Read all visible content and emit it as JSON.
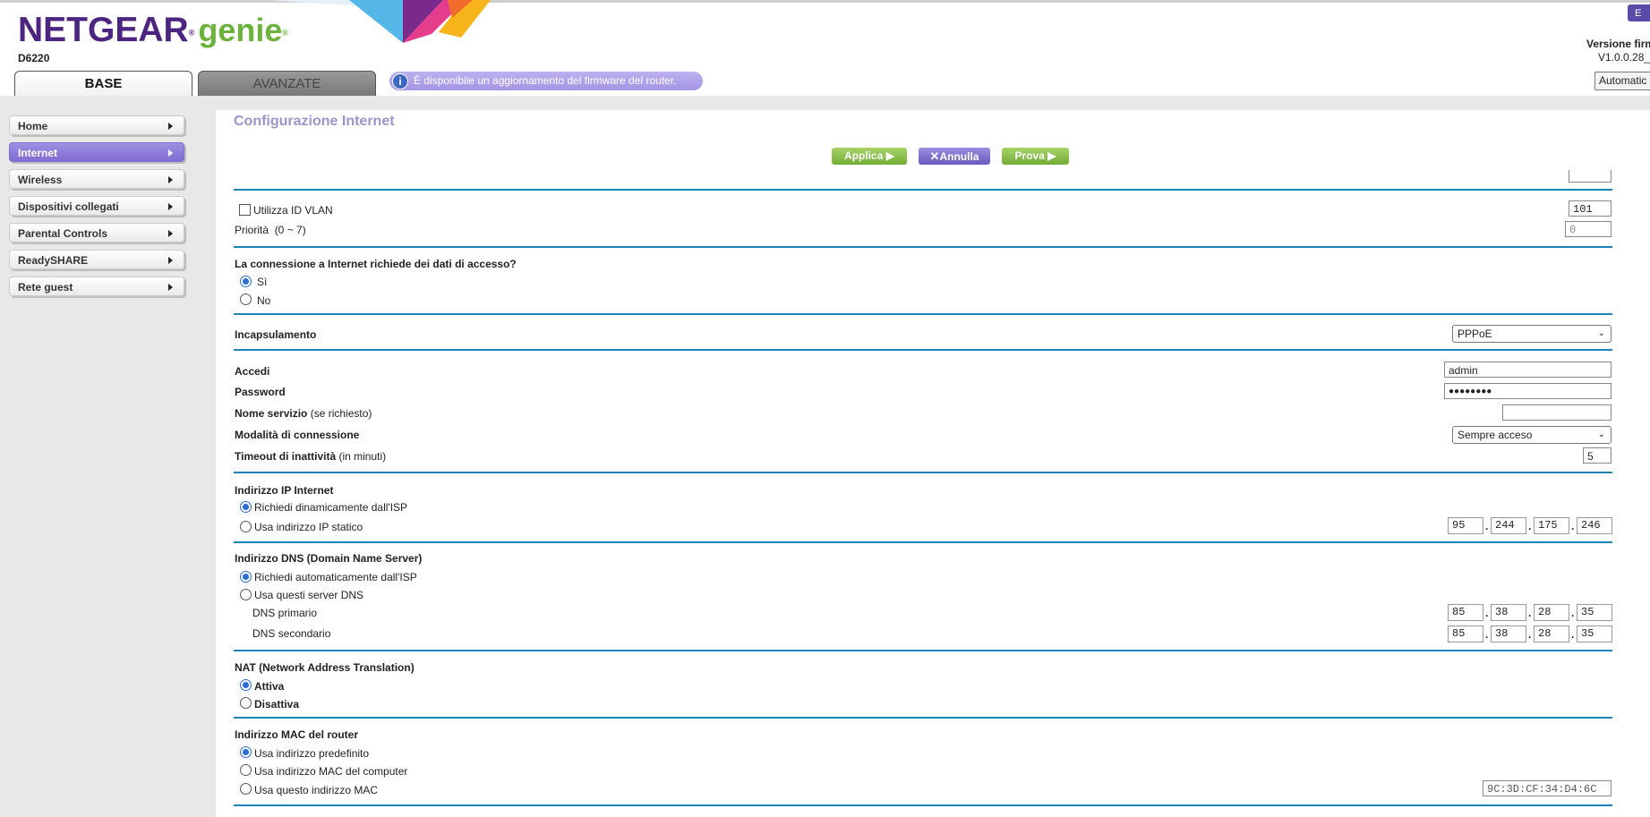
{
  "header": {
    "brand": "NETGEAR",
    "brand_reg": "®",
    "product": "genie",
    "product_reg": "®",
    "model": "D6220",
    "tabs": [
      {
        "label": "BASE",
        "active": true
      },
      {
        "label": "AVANZATE",
        "active": false
      }
    ],
    "firmware_notice": "È disponibile un aggiornamento del firmware del router.",
    "firmware_version_label": "Versione firm",
    "firmware_version": "V1.0.0.28_",
    "auto_button": "Automatic",
    "logout_button": "E"
  },
  "sidebar": {
    "items": [
      {
        "label": "Home",
        "active": false
      },
      {
        "label": "Internet",
        "active": true
      },
      {
        "label": "Wireless",
        "active": false
      },
      {
        "label": "Dispositivi collegati",
        "active": false
      },
      {
        "label": "Parental Controls",
        "active": false
      },
      {
        "label": "ReadySHARE",
        "active": false
      },
      {
        "label": "Rete guest",
        "active": false
      }
    ]
  },
  "main": {
    "title": "Configurazione Internet",
    "actions": {
      "apply": "Applica ▶",
      "cancel": "Annulla",
      "test": "Prova ▶"
    },
    "vlan": {
      "label": "Utilizza ID VLAN",
      "checked": false,
      "value": "101",
      "priority_label": "Priorità",
      "priority_range": "(0 ~ 7)",
      "priority_value": "0"
    },
    "login_required": {
      "question": "La connessione a Internet richiede dei dati di accesso?",
      "options": [
        {
          "label": "Sì",
          "selected": true
        },
        {
          "label": "No",
          "selected": false
        }
      ]
    },
    "encapsulation": {
      "label": "Incapsulamento",
      "value": "PPPoE"
    },
    "account": {
      "login_label": "Accedi",
      "login_value": "admin",
      "password_label": "Password",
      "password_value": "●●●●●●●●",
      "service_label": "Nome servizio",
      "service_hint": "(se richiesto)",
      "service_value": "",
      "mode_label": "Modalità di connessione",
      "mode_value": "Sempre acceso",
      "timeout_label": "Timeout di inattività",
      "timeout_hint": "(in minuti)",
      "timeout_value": "5"
    },
    "internet_ip": {
      "title": "Indirizzo IP Internet",
      "dynamic_label": "Richiedi dinamicamente dall'ISP",
      "dynamic_selected": true,
      "static_label": "Usa indirizzo IP statico",
      "static_selected": false,
      "ip": [
        "95",
        "244",
        "175",
        "246"
      ]
    },
    "dns": {
      "title": "Indirizzo DNS (Domain Name Server)",
      "auto_label": "Richiedi automaticamente dall'ISP",
      "auto_selected": true,
      "manual_label": "Usa questi server DNS",
      "manual_selected": false,
      "primary_label": "DNS primario",
      "primary": [
        "85",
        "38",
        "28",
        "35"
      ],
      "secondary_label": "DNS secondario",
      "secondary": [
        "85",
        "38",
        "28",
        "35"
      ]
    },
    "nat": {
      "title": "NAT (Network Address Translation)",
      "enable_label": "Attiva",
      "enable_selected": true,
      "disable_label": "Disattiva",
      "disable_selected": false
    },
    "mac": {
      "title": "Indirizzo MAC del router",
      "default_label": "Usa indirizzo predefinito",
      "default_selected": true,
      "computer_label": "Usa indirizzo MAC del computer",
      "computer_selected": false,
      "custom_label": "Usa questo indirizzo MAC",
      "custom_selected": false,
      "custom_value": "9C:3D:CF:34:D4:6C"
    }
  },
  "colors": {
    "brand_purple": "#4b2580",
    "brand_green": "#6bb33c",
    "nav_active": "#8f7fdb",
    "separator": "#1b84b6",
    "title": "#9d95c9"
  }
}
